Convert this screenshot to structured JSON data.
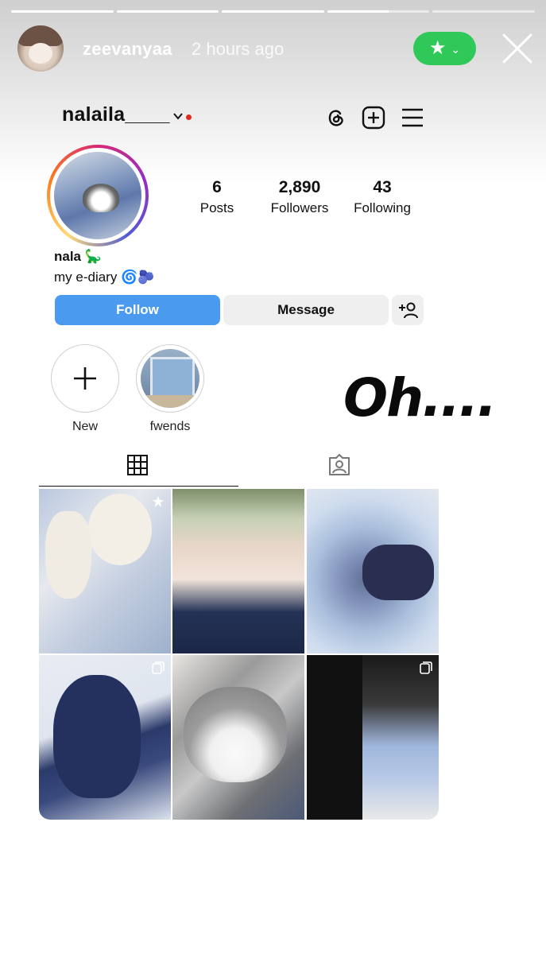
{
  "story": {
    "progress": [
      1,
      1,
      1,
      0.6,
      0
    ],
    "username": "zeevanyaa",
    "time": "2 hours ago",
    "close_friends_icon": "star-icon",
    "close_friends_color": "#2fc95a"
  },
  "profile": {
    "username": "nalaila____",
    "stats": [
      {
        "value": "6",
        "label": "Posts"
      },
      {
        "value": "2,890",
        "label": "Followers"
      },
      {
        "value": "43",
        "label": "Following"
      }
    ],
    "display_name": "nala 🦕",
    "bio": "my e-diary 🌀🫐",
    "buttons": {
      "follow": "Follow",
      "message": "Message"
    },
    "follow_color": "#4a9bf0"
  },
  "highlights": [
    {
      "label": "New"
    },
    {
      "label": "fwends"
    }
  ],
  "overlay_text": "Oh....",
  "grid_icons": [
    "grid-icon",
    "tagged-icon"
  ]
}
